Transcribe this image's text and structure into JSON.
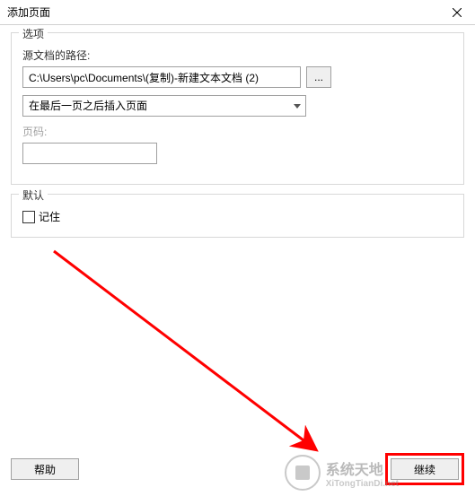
{
  "dialog": {
    "title": "添加页面"
  },
  "options": {
    "legend": "选项",
    "source_label": "源文档的路径:",
    "source_path": "C:\\Users\\pc\\Documents\\(复制)-新建文本文档 (2)",
    "browse_label": "...",
    "insert_position": "在最后一页之后插入页面",
    "page_label": "页码:",
    "page_value": ""
  },
  "defaults": {
    "legend": "默认",
    "remember_label": "记住",
    "remember_checked": false
  },
  "buttons": {
    "help": "帮助",
    "continue": "继续"
  },
  "watermark": {
    "main": "系统天地",
    "sub": "XiTongTianDi.net"
  }
}
